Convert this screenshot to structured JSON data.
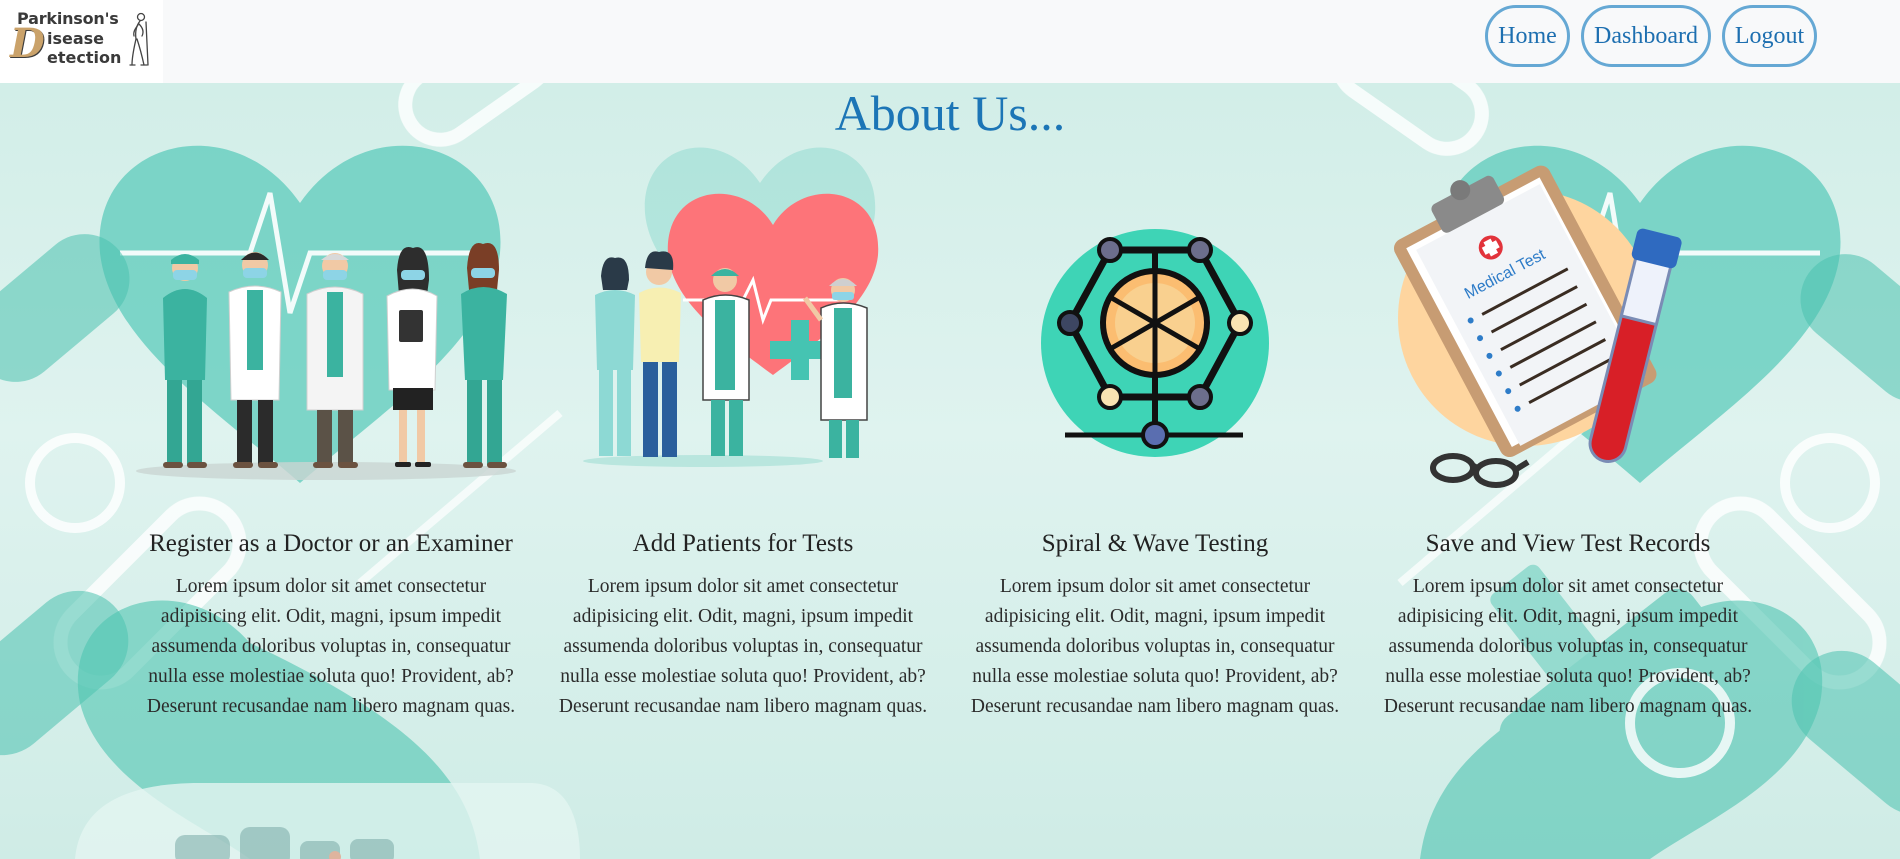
{
  "header": {
    "logo": {
      "line1": "Parkinson's",
      "big_letter": "D",
      "line2": "isease",
      "line3": "etection"
    },
    "nav": [
      {
        "label": "Home"
      },
      {
        "label": "Dashboard"
      },
      {
        "label": "Logout"
      }
    ]
  },
  "main": {
    "title": "About Us...",
    "cards": [
      {
        "heading": "Register as a Doctor or an Examiner",
        "text": "Lorem ipsum dolor sit amet consectetur adipisicing elit. Odit, magni, ipsum impedit assumenda doloribus voluptas in, consequatur nulla esse molestiae soluta quo! Provident, ab? Deserunt recusandae nam libero magnam quas."
      },
      {
        "heading": "Add Patients for Tests",
        "text": "Lorem ipsum dolor sit amet consectetur adipisicing elit. Odit, magni, ipsum impedit assumenda doloribus voluptas in, consequatur nulla esse molestiae soluta quo! Provident, ab? Deserunt recusandae nam libero magnam quas."
      },
      {
        "heading": "Spiral & Wave Testing",
        "text": "Lorem ipsum dolor sit amet consectetur adipisicing elit. Odit, magni, ipsum impedit assumenda doloribus voluptas in, consequatur nulla esse molestiae soluta quo! Provident, ab? Deserunt recusandae nam libero magnam quas."
      },
      {
        "heading": "Save and View Test Records",
        "text": "Lorem ipsum dolor sit amet consectetur adipisicing elit. Odit, magni, ipsum impedit assumenda doloribus voluptas in, consequatur nulla esse molestiae soluta quo! Provident, ab? Deserunt recusandae nam libero magnam quas."
      }
    ],
    "clipboard_label": "Medical Test"
  },
  "colors": {
    "accent_blue": "#1c75b6",
    "nav_border": "#65a8d4",
    "teal": "#47c6b4",
    "background": "#d6efea"
  }
}
